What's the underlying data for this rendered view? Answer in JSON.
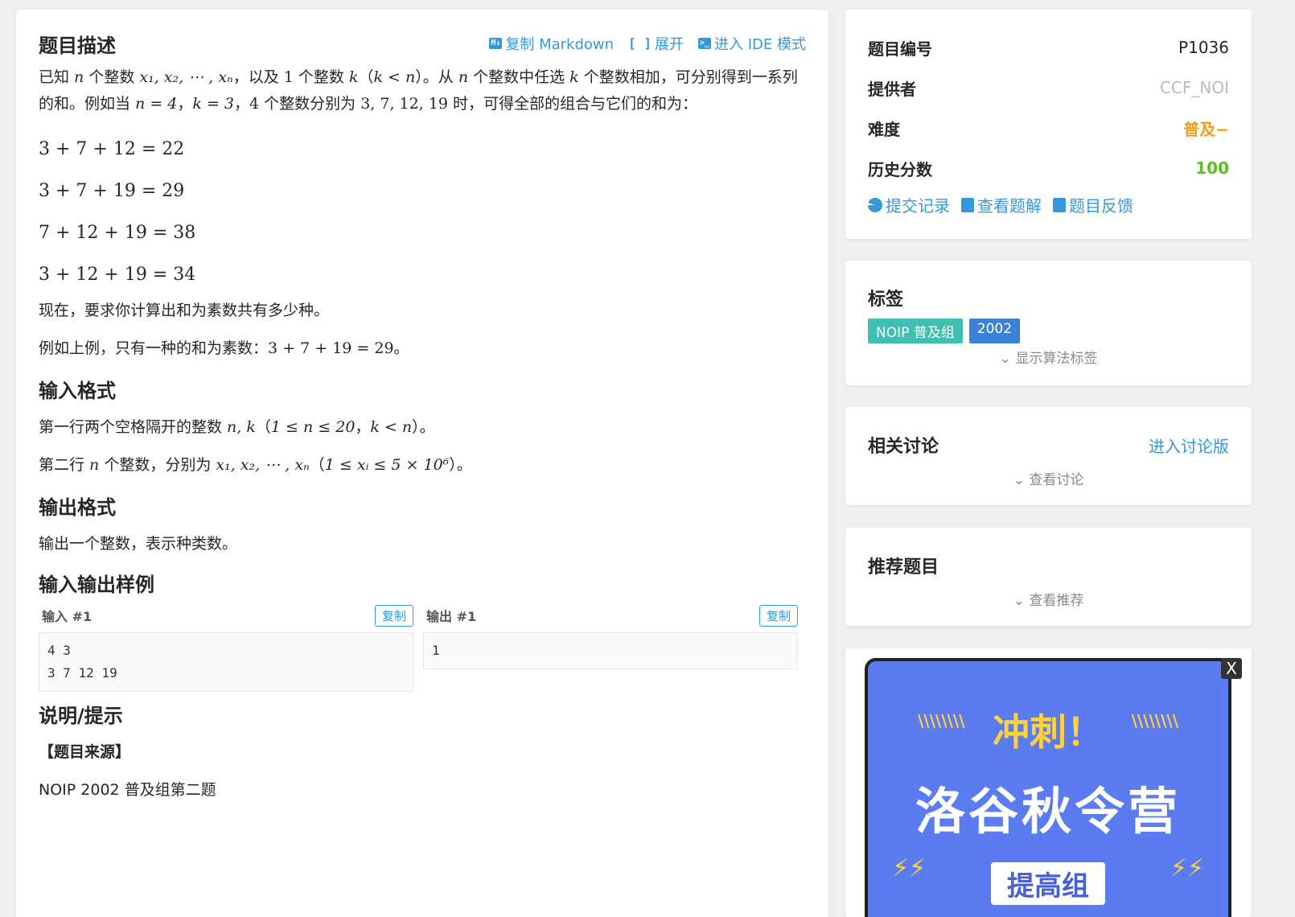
{
  "problem": {
    "title": "题目描述",
    "actions": [
      {
        "icon": "M↓",
        "label": "复制 Markdown"
      },
      {
        "icon": "[ ]",
        "label": "展开"
      },
      {
        "icon": ">_",
        "label": "进入 IDE 模式"
      }
    ],
    "desc_parts": {
      "p1a": "已知 ",
      "p1n": "n",
      "p1b": " 个整数 ",
      "p1x": "x₁, x₂, ⋯ , xₙ",
      "p1c": "，以及 ",
      "p1one": "1",
      "p1d": " 个整数 ",
      "p1k": "k",
      "p1e": "（",
      "p1kn": "k < n",
      "p1f": "）。从 ",
      "p1n2": "n",
      "p1g": " 个整数中任选 ",
      "p1k2": "k",
      "p1h": " 个整数相加，可分别得到一系列的和。例如当 ",
      "p1n4": "n = 4",
      "p1i": "，",
      "p1k3": "k = 3",
      "p1j": "，",
      "p1four": "4",
      "p1l": " 个整数分别为 ",
      "p1set": "3, 7, 12, 19",
      "p1m": " 时，可得全部的组合与它们的和为："
    },
    "equations": [
      "3 + 7 + 12 = 22",
      "3 + 7 + 19 = 29",
      "7 + 12 + 19 = 38",
      "3 + 12 + 19 = 34"
    ],
    "p2": "现在，要求你计算出和为素数共有多少种。",
    "p3a": "例如上例，只有一种的和为素数：",
    "p3eq": "3 + 7 + 19 = 29",
    "p3b": "。",
    "input_title": "输入格式",
    "in1a": "第一行两个空格隔开的整数 ",
    "in1m": "n, k",
    "in1b": "（",
    "in1c": "1 ≤ n ≤ 20",
    "in1d": "，",
    "in1e": "k < n",
    "in1f": "）。",
    "in2a": "第二行 ",
    "in2n": "n",
    "in2b": " 个整数，分别为 ",
    "in2x": "x₁, x₂, ⋯ , xₙ",
    "in2c": "（",
    "in2d": "1 ≤ xᵢ ≤ 5 × 10⁶",
    "in2e": "）。",
    "output_title": "输出格式",
    "out1": "输出一个整数，表示种类数。",
    "samples_title": "输入输出样例",
    "sample_in_label": "输入 #1",
    "sample_out_label": "输出 #1",
    "copy_label": "复制",
    "sample_in": "4 3\n3 7 12 19",
    "sample_out": "1",
    "hint_title": "说明/提示",
    "source_title": "【题目来源】",
    "source_text": "NOIP 2002 普及组第二题"
  },
  "info": {
    "rows": [
      {
        "key": "题目编号",
        "value": "P1036",
        "color": "#262626"
      },
      {
        "key": "提供者",
        "value": "CCF_NOI",
        "color": "#bbbbbb"
      },
      {
        "key": "难度",
        "value": "普及−",
        "color": "#f39c11"
      },
      {
        "key": "历史分数",
        "value": "100",
        "color": "#52c41a"
      }
    ],
    "links": [
      "提交记录",
      "查看题解",
      "题目反馈"
    ]
  },
  "tags": {
    "title": "标签",
    "items": [
      {
        "label": "NOIP 普及组",
        "color": "#3ebfb0"
      },
      {
        "label": "2002",
        "color": "#3b82d6"
      }
    ],
    "show_more": "显示算法标签"
  },
  "discuss": {
    "title": "相关讨论",
    "link": "进入讨论版",
    "show_more": "查看讨论"
  },
  "recommend": {
    "title": "推荐题目",
    "show_more": "查看推荐"
  },
  "ad": {
    "line1": "冲刺！",
    "line2": "洛谷秋令营",
    "line3": "提高组",
    "close": "X"
  }
}
